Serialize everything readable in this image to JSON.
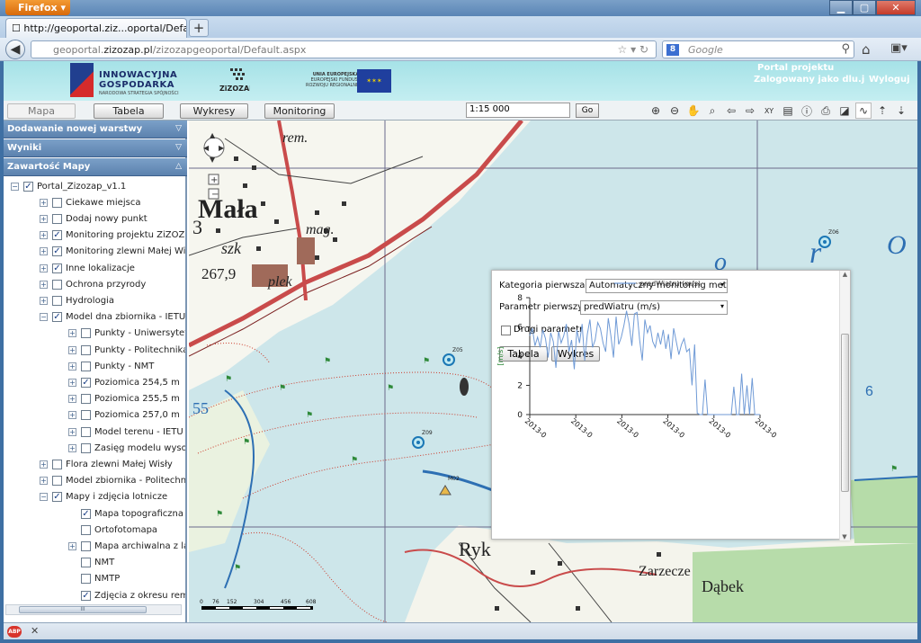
{
  "browser": {
    "app_button": "Firefox",
    "tab_title": "http://geoportal.ziz...oportal/Default.aspx",
    "new_tab": "+",
    "url_prefix": "geoportal.",
    "url_domain": "zizozap.pl",
    "url_path": "/zizozapgeoportal/Default.aspx",
    "search_placeholder": "Google",
    "statusbar_icon": "ABP"
  },
  "header": {
    "logo1_line1": "INNOWACYJNA",
    "logo1_line2": "GOSPODARKA",
    "logo1_sub": "NARODOWA STRATEGIA SPÓJNOŚCI",
    "logo2": "ZiZOZAP",
    "logo3_line1": "UNIA EUROPEJSKA",
    "logo3_line2": "EUROPEJSKI FUNDUSZ",
    "logo3_line3": "ROZWOJU REGIONALNEGO",
    "portal_link": "Portal projektu",
    "logged_as": "Zalogowany jako dlu.j",
    "logout": "Wyloguj"
  },
  "toolbar": {
    "tabs": [
      "Mapa",
      "Tabela",
      "Wykresy",
      "Monitoring"
    ],
    "scale_value": "1:15 000",
    "go_label": "Go",
    "tool_icons": [
      "zoom-in-icon",
      "zoom-out-icon",
      "pan-hand-icon",
      "zoom-box-icon",
      "back-arrow-icon",
      "forward-arrow-icon",
      "xy-icon",
      "select-icon",
      "info-icon",
      "print-icon",
      "layer-icon",
      "chart-icon",
      "export-icon",
      "import-icon"
    ]
  },
  "sidebar": {
    "panels": [
      "Dodawanie nowej warstwy",
      "Wyniki",
      "Zawartość Mapy"
    ],
    "tree": [
      {
        "label": "Portal_Zizozap_v1.1",
        "checked": true,
        "expander": "−",
        "level": 0
      },
      {
        "label": "Ciekawe miejsca",
        "checked": false,
        "expander": "+",
        "level": 1
      },
      {
        "label": "Dodaj nowy punkt",
        "checked": false,
        "expander": "+",
        "level": 1
      },
      {
        "label": "Monitoring projektu ZiZOZap",
        "checked": true,
        "expander": "+",
        "level": 1
      },
      {
        "label": "Monitoring zlewni Małej Wisły",
        "checked": true,
        "expander": "+",
        "level": 1
      },
      {
        "label": "Inne lokalizacje",
        "checked": true,
        "expander": "+",
        "level": 1
      },
      {
        "label": "Ochrona przyrody",
        "checked": false,
        "expander": "+",
        "level": 1
      },
      {
        "label": "Hydrologia",
        "checked": false,
        "expander": "+",
        "level": 1
      },
      {
        "label": "Model dna zbiornika - IETU",
        "checked": true,
        "expander": "−",
        "level": 1
      },
      {
        "label": "Punkty - Uniwersytet Ś",
        "checked": false,
        "expander": "+",
        "level": 2
      },
      {
        "label": "Punkty - Politechnika K",
        "checked": false,
        "expander": "+",
        "level": 2
      },
      {
        "label": "Punkty - NMT",
        "checked": false,
        "expander": "+",
        "level": 2
      },
      {
        "label": "Poziomica 254,5 m",
        "checked": true,
        "expander": "+",
        "level": 2
      },
      {
        "label": "Poziomica 255,5 m",
        "checked": false,
        "expander": "+",
        "level": 2
      },
      {
        "label": "Poziomica 257,0 m",
        "checked": false,
        "expander": "+",
        "level": 2
      },
      {
        "label": "Model terenu - IETU",
        "checked": false,
        "expander": "+",
        "level": 2
      },
      {
        "label": "Zasięg modelu wysokoś",
        "checked": false,
        "expander": "+",
        "level": 2
      },
      {
        "label": "Flora zlewni Małej Wisły",
        "checked": false,
        "expander": "+",
        "level": 1
      },
      {
        "label": "Model zbiornika - Politechnika l",
        "checked": false,
        "expander": "+",
        "level": 1
      },
      {
        "label": "Mapy i zdjęcia lotnicze",
        "checked": true,
        "expander": "−",
        "level": 1
      },
      {
        "label": "Mapa topograficzna 1:5",
        "checked": true,
        "expander": "",
        "level": 2
      },
      {
        "label": "Ortofotomapa",
        "checked": false,
        "expander": "",
        "level": 2
      },
      {
        "label": "Mapa archiwalna z lat",
        "checked": false,
        "expander": "+",
        "level": 2
      },
      {
        "label": "NMT",
        "checked": false,
        "expander": "",
        "level": 2
      },
      {
        "label": "NMTP",
        "checked": false,
        "expander": "",
        "level": 2
      },
      {
        "label": "Zdjęcia z okresu remo",
        "checked": true,
        "expander": "",
        "level": 2
      }
    ],
    "hscroll_label": "III"
  },
  "map": {
    "labels": {
      "town": "Mała",
      "num3": "3",
      "szk": "szk",
      "mag": "mag.",
      "plek": "plek",
      "rem": "rem.",
      "elev": "267,9",
      "num55": "55",
      "num6": "6",
      "ryk": "Ryk",
      "zarzecze": "Zarzecze",
      "dabek": "Dąbek",
      "lake_o1": "o",
      "lake_r": "r",
      "lake_o2": "O"
    },
    "stations": [
      "Z06",
      "Z05",
      "Z09",
      "M02"
    ],
    "scalebar": [
      "0",
      "76",
      "152",
      "304",
      "456",
      "608 N"
    ]
  },
  "popup": {
    "cat1_label": "Kategoria pierwsza:",
    "cat1_value": "Automatyczny monitoring mete",
    "param1_label": "Parametr pierwszy:",
    "param1_value": "predWiatru (m/s)",
    "second_param_label": "Drugi parametr",
    "table_button": "Tabela",
    "chart_button": "Wykres"
  },
  "chart_data": {
    "type": "line",
    "series": [
      {
        "name": "predWiatru (m/s)",
        "color": "#6f9ad6",
        "values": [
          5.4,
          5.9,
          4.7,
          5.3,
          4.6,
          5.8,
          5.2,
          3.9,
          5.6,
          5.0,
          3.2,
          5.7,
          4.9,
          5.4,
          6.2,
          4.3,
          5.1,
          3.1,
          5.8,
          4.9,
          6.2,
          3.7,
          5.5,
          6.5,
          4.6,
          5.1,
          6.3,
          5.9,
          4.9,
          4.3,
          6.6,
          5.4,
          3.9,
          6.7,
          4.8,
          5.3,
          6.1,
          7.1,
          6.2,
          4.7,
          6.9,
          7.0,
          5.1,
          3.7,
          6.5,
          5.6,
          6.1,
          5.0,
          4.6,
          5.6,
          4.8,
          5.8,
          4.5,
          5.5,
          3.8,
          5.9,
          5.0,
          4.1,
          4.8,
          5.2,
          4.3,
          4.5,
          2.0,
          4.8,
          0.1,
          0.0,
          0.0,
          2.4,
          0.0,
          0.0,
          0.0,
          0.0,
          0.0,
          0.0,
          0.0,
          0.0,
          0.0,
          0.0,
          1.9,
          0.0,
          0.0,
          2.8,
          0.0,
          2.0,
          0.0,
          2.5,
          0.0,
          0.0,
          0.0
        ]
      }
    ],
    "ylabel": "[m/s]",
    "ylim": [
      0,
      8
    ],
    "yticks": [
      0,
      2,
      4,
      6,
      8
    ],
    "xticks": [
      "2013-0",
      "2013-0",
      "2013-0",
      "2013-0",
      "2013-0",
      "2013-0"
    ],
    "legend": "top-center"
  }
}
